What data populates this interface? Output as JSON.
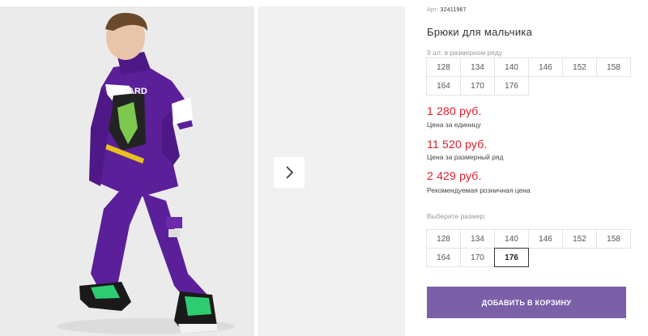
{
  "product": {
    "article_prefix": "Арт:",
    "article_value": "32411967",
    "title": "Брюки для мальчика",
    "pack_note": "9 шт. в размерном ряду",
    "photo_alt": "Мальчик в фиолетовом костюме"
  },
  "size_range": [
    "128",
    "134",
    "140",
    "146",
    "152",
    "158",
    "164",
    "170",
    "176"
  ],
  "prices": {
    "unit_price": "1 280 руб.",
    "unit_label": "Цена за единицу",
    "range_price": "11 520 руб.",
    "range_label": "Цена за размерный ряд",
    "retail_price": "2 429 руб.",
    "retail_label": "Рекомендуемая розничная цена"
  },
  "size_picker": {
    "label": "Выберите размер:",
    "sizes": [
      "128",
      "134",
      "140",
      "146",
      "152",
      "158",
      "164",
      "170",
      "176"
    ],
    "selected": "176"
  },
  "actions": {
    "add_to_cart": "ДОБАВИТЬ В КОРЗИНУ"
  },
  "icons": {
    "next": "chevron-right-icon"
  },
  "colors": {
    "accent": "#7b60a8",
    "price": "#d91c2a",
    "garment": "#5b1f9a"
  }
}
